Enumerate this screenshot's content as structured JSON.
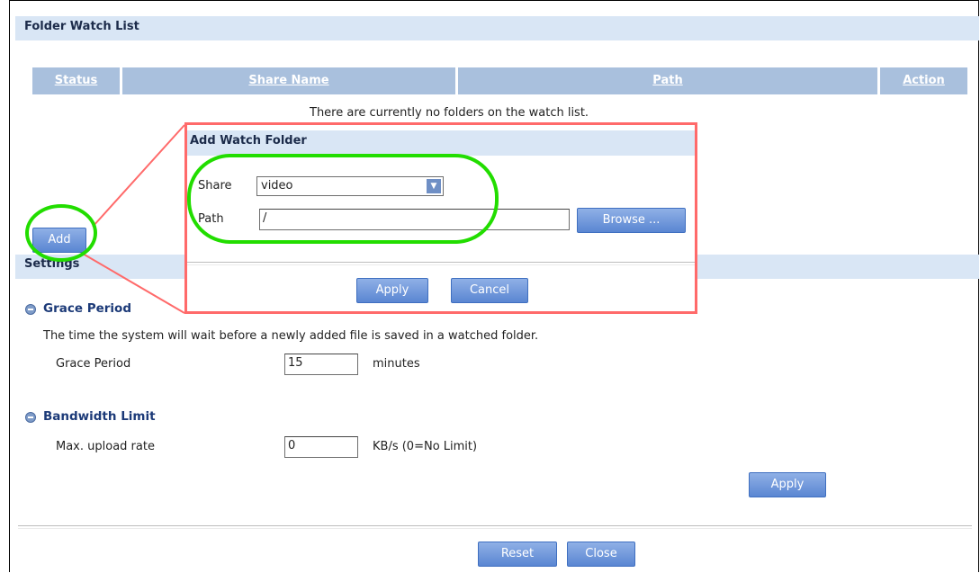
{
  "folder_watch": {
    "title": "Folder Watch List",
    "columns": [
      "Status",
      "Share Name",
      "Path",
      "Action"
    ],
    "empty_message": "There are currently no folders on the watch list.",
    "add_label": "Add"
  },
  "add_watch_folder": {
    "title": "Add Watch Folder",
    "share_label": "Share",
    "share_value": "video",
    "path_label": "Path",
    "path_value": "/",
    "browse_label": "Browse ...",
    "apply_label": "Apply",
    "cancel_label": "Cancel"
  },
  "settings": {
    "title": "Settings",
    "grace": {
      "heading": "Grace Period",
      "description": "The time the system will wait before a newly added file is saved in a watched folder.",
      "label": "Grace Period",
      "value": "15",
      "unit": "minutes"
    },
    "bandwidth": {
      "heading": "Bandwidth Limit",
      "label": "Max. upload rate",
      "value": "0",
      "unit": "KB/s (0=No Limit)"
    },
    "apply_label": "Apply"
  },
  "footer": {
    "reset_label": "Reset",
    "close_label": "Close"
  },
  "colors": {
    "highlight_green": "#22dd00",
    "callout_red": "#ff6a6a",
    "header_blue": "#a9c0dd"
  }
}
